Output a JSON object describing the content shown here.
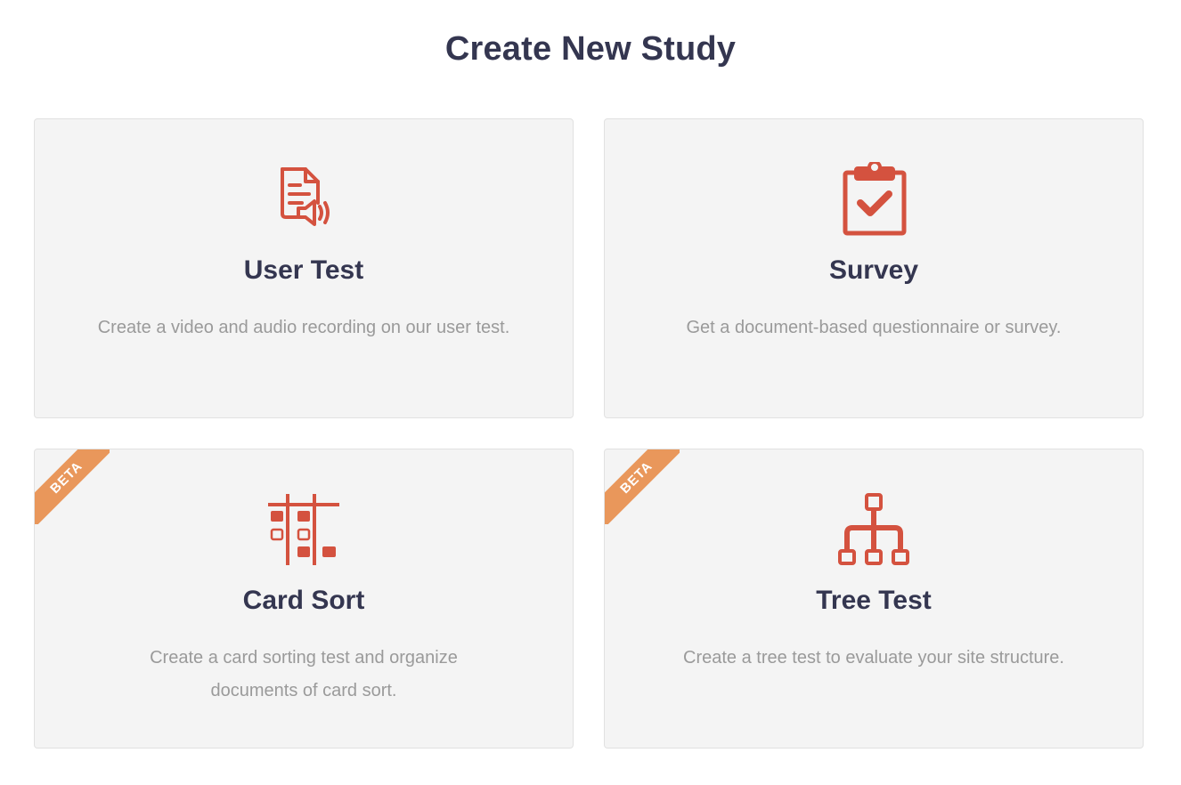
{
  "page": {
    "title": "Create New Study"
  },
  "colors": {
    "icon": "#d4523f",
    "ribbon": "#e9975b",
    "title": "#343650",
    "description": "#9a9a9a",
    "card_bg": "#f4f4f4"
  },
  "cards": [
    {
      "title": "User Test",
      "description": "Create a video and audio recording on our user test.",
      "icon": "document-audio-icon",
      "ribbon": ""
    },
    {
      "title": "Survey",
      "description": "Get a document-based questionnaire or survey.",
      "icon": "clipboard-check-icon",
      "ribbon": ""
    },
    {
      "title": "Card Sort",
      "description": "Create a card sorting test and organize documents of card sort.",
      "icon": "card-sort-grid-icon",
      "ribbon": "BETA"
    },
    {
      "title": "Tree Test",
      "description": "Create a tree test to evaluate your site structure.",
      "icon": "sitemap-tree-icon",
      "ribbon": "BETA"
    }
  ]
}
